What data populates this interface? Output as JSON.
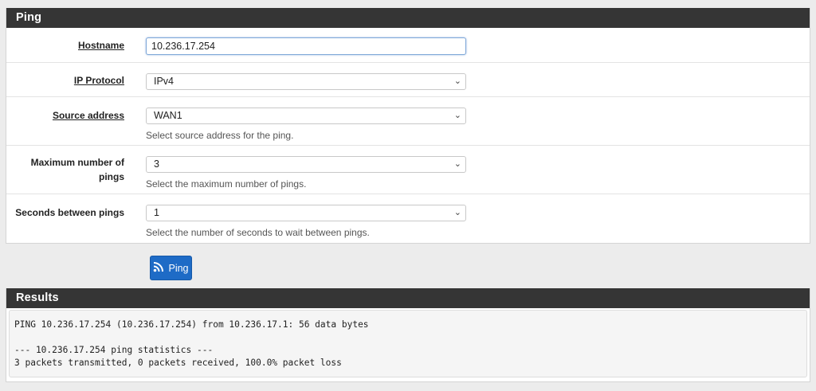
{
  "ping_panel": {
    "title": "Ping",
    "hostname": {
      "label": "Hostname",
      "value": "10.236.17.254"
    },
    "ip_protocol": {
      "label": "IP Protocol",
      "value": "IPv4"
    },
    "source_address": {
      "label": "Source address",
      "value": "WAN1",
      "help": "Select source address for the ping."
    },
    "max_pings": {
      "label_line1": "Maximum number of",
      "label_line2": "pings",
      "value": "3",
      "help": "Select the maximum number of pings."
    },
    "seconds_between": {
      "label": "Seconds between pings",
      "value": "1",
      "help": "Select the number of seconds to wait between pings."
    }
  },
  "ping_button": {
    "label": "Ping",
    "icon": "rss-icon",
    "color": "#1e6bc6"
  },
  "results_panel": {
    "title": "Results",
    "lines": [
      "PING 10.236.17.254 (10.236.17.254) from 10.236.17.1: 56 data bytes",
      "",
      "--- 10.236.17.254 ping statistics ---",
      "3 packets transmitted, 0 packets received, 100.0% packet loss"
    ]
  }
}
